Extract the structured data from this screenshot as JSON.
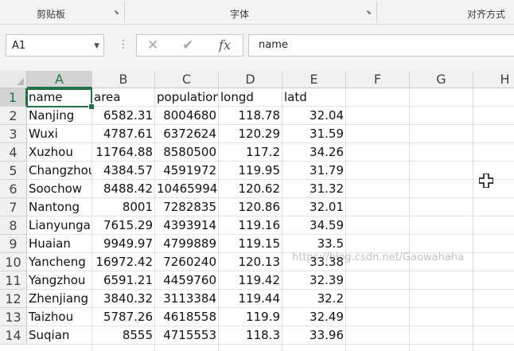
{
  "ribbon": {
    "groups": [
      {
        "label": "剪贴板",
        "has_launcher": true
      },
      {
        "label": "字体",
        "has_launcher": true
      },
      {
        "label": "对齐方式",
        "has_launcher": false
      }
    ]
  },
  "formula_bar": {
    "name_box": "A1",
    "cancel_icon": "close-icon",
    "enter_icon": "check-icon",
    "function_label": "fx",
    "formula": "name"
  },
  "sheet": {
    "columns": [
      "A",
      "B",
      "C",
      "D",
      "E",
      "F",
      "G",
      "H"
    ],
    "rows": [
      "1",
      "2",
      "3",
      "4",
      "5",
      "6",
      "7",
      "8",
      "9",
      "10",
      "11",
      "12",
      "13",
      "14"
    ],
    "selected_cell": "A1",
    "header": [
      "name",
      "area",
      "population",
      "longd",
      "latd"
    ],
    "data": [
      [
        "Nanjing",
        "6582.31",
        "8004680",
        "118.78",
        "32.04"
      ],
      [
        "Wuxi",
        "4787.61",
        "6372624",
        "120.29",
        "31.59"
      ],
      [
        "Xuzhou",
        "11764.88",
        "8580500",
        "117.2",
        "34.26"
      ],
      [
        "Changzhou",
        "4384.57",
        "4591972",
        "119.95",
        "31.79"
      ],
      [
        "Soochow",
        "8488.42",
        "10465994",
        "120.62",
        "31.32"
      ],
      [
        "Nantong",
        "8001",
        "7282835",
        "120.86",
        "32.01"
      ],
      [
        "Lianyungang",
        "7615.29",
        "4393914",
        "119.16",
        "34.59"
      ],
      [
        "Huaian",
        "9949.97",
        "4799889",
        "119.15",
        "33.5"
      ],
      [
        "Yancheng",
        "16972.42",
        "7260240",
        "120.13",
        "33.38"
      ],
      [
        "Yangzhou",
        "6591.21",
        "4459760",
        "119.42",
        "32.39"
      ],
      [
        "Zhenjiang",
        "3840.32",
        "3113384",
        "119.44",
        "32.2"
      ],
      [
        "Taizhou",
        "5787.26",
        "4618558",
        "119.9",
        "32.49"
      ],
      [
        "Suqian",
        "8555",
        "4715553",
        "118.3",
        "33.96"
      ]
    ]
  },
  "watermark": "https://blog.csdn.net/Gaowahaha",
  "colors": {
    "accent": "#217346"
  }
}
